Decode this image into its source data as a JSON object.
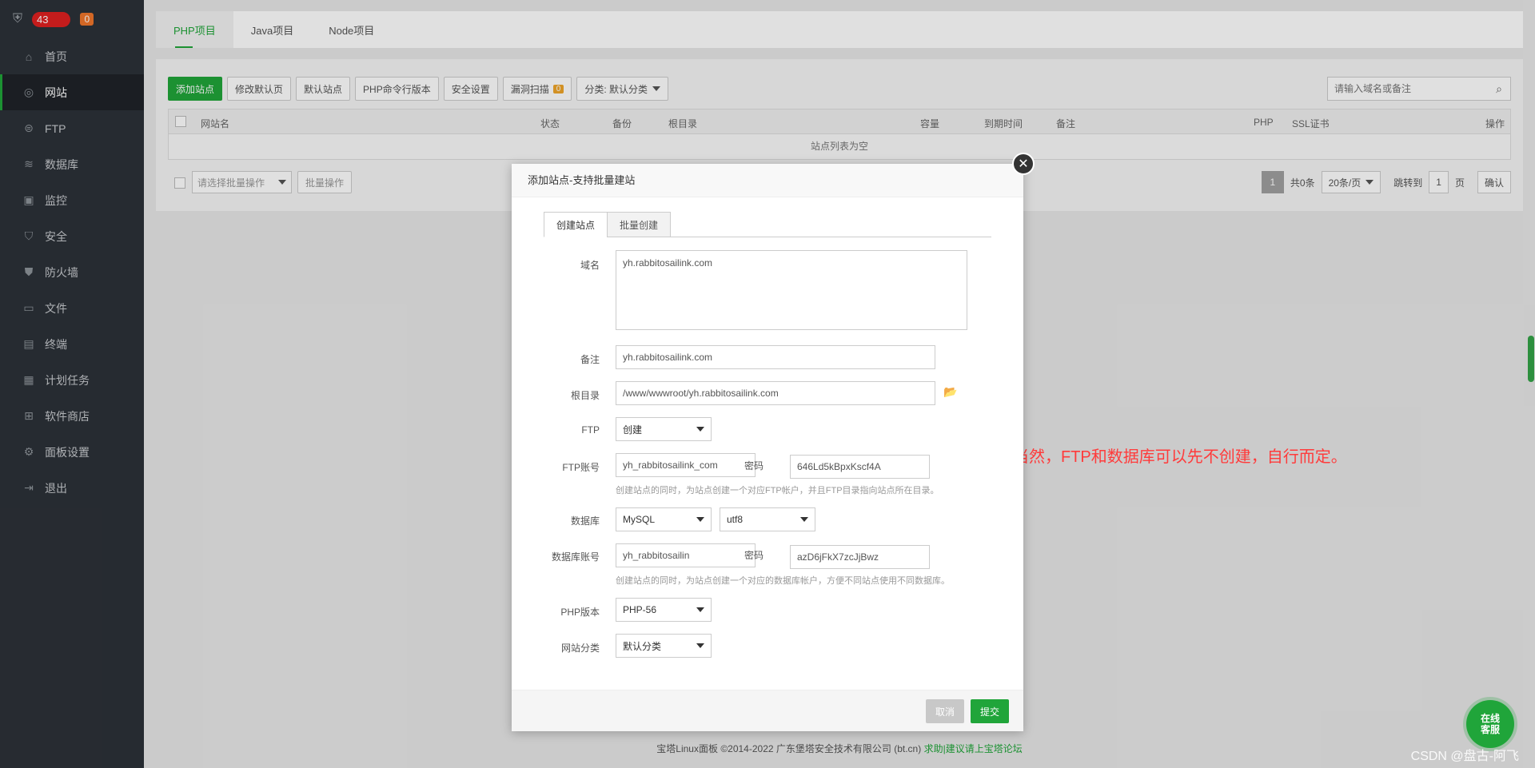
{
  "sidebar": {
    "host_label": "43",
    "badge": "0",
    "items": [
      {
        "label": "首页",
        "icon": "home-icon"
      },
      {
        "label": "网站",
        "icon": "globe-icon"
      },
      {
        "label": "FTP",
        "icon": "ftp-icon"
      },
      {
        "label": "数据库",
        "icon": "database-icon"
      },
      {
        "label": "监控",
        "icon": "monitor-icon"
      },
      {
        "label": "安全",
        "icon": "shield-icon"
      },
      {
        "label": "防火墙",
        "icon": "firewall-icon"
      },
      {
        "label": "文件",
        "icon": "folder-icon"
      },
      {
        "label": "终端",
        "icon": "terminal-icon"
      },
      {
        "label": "计划任务",
        "icon": "calendar-icon"
      },
      {
        "label": "软件商店",
        "icon": "apps-icon"
      },
      {
        "label": "面板设置",
        "icon": "gear-icon"
      },
      {
        "label": "退出",
        "icon": "logout-icon"
      }
    ],
    "active_index": 1
  },
  "tabs": [
    "PHP项目",
    "Java项目",
    "Node项目"
  ],
  "toolbar": {
    "add_site": "添加站点",
    "edit_default_page": "修改默认页",
    "default_site": "默认站点",
    "php_cli": "PHP命令行版本",
    "security": "安全设置",
    "vuln_scan": "漏洞扫描",
    "vuln_count": "0",
    "category": "分类: 默认分类"
  },
  "search": {
    "placeholder": "请输入域名或备注"
  },
  "table": {
    "headers": [
      "网站名",
      "状态",
      "备份",
      "根目录",
      "容量",
      "到期时间",
      "备注",
      "PHP",
      "SSL证书",
      "操作"
    ],
    "empty_text": "站点列表为空"
  },
  "batch": {
    "select_placeholder": "请选择批量操作",
    "button": "批量操作"
  },
  "pager": {
    "current": "1",
    "total": "共0条",
    "per_page": "20条/页",
    "jump_label": "跳转到",
    "jump_value": "1",
    "page_unit": "页",
    "confirm": "确认"
  },
  "modal": {
    "title": "添加站点-支持批量建站",
    "tabs": [
      "创建站点",
      "批量创建"
    ],
    "domain_label": "域名",
    "domain_value": "yh.rabbitosailink.com",
    "remark_label": "备注",
    "remark_value": "yh.rabbitosailink.com",
    "root_label": "根目录",
    "root_value": "/www/wwwroot/yh.rabbitosailink.com",
    "ftp_label": "FTP",
    "ftp_value": "创建",
    "ftp_account_label": "FTP账号",
    "ftp_account_value": "yh_rabbitosailink_com",
    "ftp_password_label": "密码",
    "ftp_password_value": "646Ld5kBpxKscf4A",
    "ftp_hint": "创建站点的同时，为站点创建一个对应FTP帐户，并且FTP目录指向站点所在目录。",
    "db_label": "数据库",
    "db_type": "MySQL",
    "db_charset": "utf8",
    "db_account_label": "数据库账号",
    "db_account_value": "yh_rabbitosailin",
    "db_password_label": "密码",
    "db_password_value": "azD6jFkX7zcJjBwz",
    "db_hint": "创建站点的同时，为站点创建一个对应的数据库帐户，方便不同站点使用不同数据库。",
    "php_label": "PHP版本",
    "php_value": "PHP-56",
    "category_label": "网站分类",
    "category_value": "默认分类",
    "cancel": "取消",
    "submit": "提交"
  },
  "annotation": "当然，FTP和数据库可以先不创建，自行而定。",
  "footer": {
    "copyright": "宝塔Linux面板 ©2014-2022 广东堡塔安全技术有限公司 (bt.cn)",
    "link": "求助|建议请上宝塔论坛"
  },
  "watermark": "CSDN @盘古-阿飞",
  "chat": {
    "line1": "在线",
    "line2": "客服"
  },
  "colors": {
    "accent": "#20a53a",
    "sidebar": "#2c3138",
    "annotation": "#ff3b3b"
  }
}
